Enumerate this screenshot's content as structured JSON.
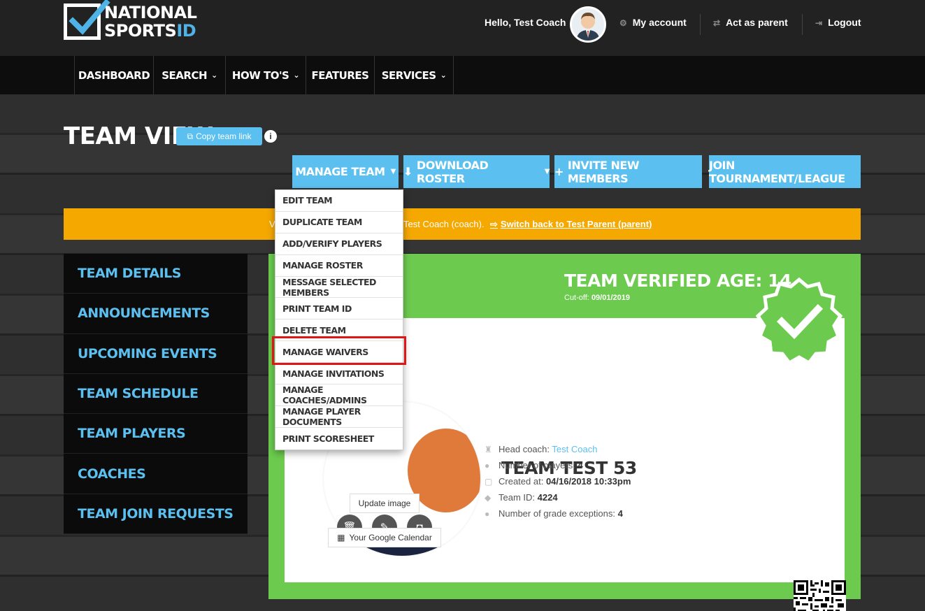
{
  "header": {
    "logo": {
      "line1": "NATIONAL",
      "line2_main": "SPORTS",
      "line2_accent": "ID"
    },
    "greeting": "Hello, Test Coach",
    "links": [
      {
        "label": "My account",
        "icon": "gear-icon"
      },
      {
        "label": "Act as parent",
        "icon": "swap-icon"
      },
      {
        "label": "Logout",
        "icon": "logout-icon"
      }
    ]
  },
  "nav": {
    "items": [
      {
        "label": "DASHBOARD",
        "dropdown": false
      },
      {
        "label": "SEARCH",
        "dropdown": true
      },
      {
        "label": "HOW TO'S",
        "dropdown": true
      },
      {
        "label": "FEATURES",
        "dropdown": false
      },
      {
        "label": "SERVICES",
        "dropdown": true
      }
    ]
  },
  "page": {
    "title": "TEAM VIEW",
    "copy_link": "Copy team link",
    "actions": {
      "manage_team": "MANAGE TEAM",
      "download_roster": "DOWNLOAD ROSTER",
      "invite": "INVITE NEW MEMBERS",
      "join": "JOIN TOURNAMENT/LEAGUE"
    },
    "notice": {
      "prefix": "V",
      "mid": "Test Coach (coach).",
      "switch_link": "Switch back to Test Parent (parent)"
    }
  },
  "sidebar": {
    "items": [
      "TEAM DETAILS",
      "ANNOUNCEMENTS",
      "UPCOMING EVENTS",
      "TEAM SCHEDULE",
      "TEAM PLAYERS",
      "COACHES",
      "TEAM JOIN REQUESTS"
    ]
  },
  "dropdown": {
    "items": [
      "EDIT TEAM",
      "DUPLICATE TEAM",
      "ADD/VERIFY PLAYERS",
      "MANAGE ROSTER",
      "MESSAGE SELECTED MEMBERS",
      "PRINT TEAM ID",
      "DELETE TEAM",
      "MANAGE WAIVERS",
      "MANAGE INVITATIONS",
      "MANAGE COACHES/ADMINS",
      "MANAGE PLAYER DOCUMENTS",
      "PRINT SCORESHEET"
    ],
    "highlighted": "MANAGE WAIVERS"
  },
  "team": {
    "verified_age_title": "TEAM VERIFIED AGE: 14",
    "cutoff_label": "Cut-off:",
    "cutoff_value": "09/01/2019",
    "name": "TEAM TEST 53",
    "head_coach_label": "Head coach:",
    "head_coach": "Test Coach",
    "players_label": "Number of players:",
    "players": "4",
    "created_label": "Created at:",
    "created": "04/16/2018 10:33pm",
    "team_id_label": "Team ID:",
    "team_id": "4224",
    "grade_exc_label": "Number of grade exceptions:",
    "grade_exc": "4",
    "update_image": "Update image",
    "google_calendar": "Your Google Calendar"
  },
  "colors": {
    "accent_blue": "#5bc0f0",
    "green": "#6ccb4e",
    "notice_orange": "#f5a800",
    "highlight_red": "#e01515"
  }
}
